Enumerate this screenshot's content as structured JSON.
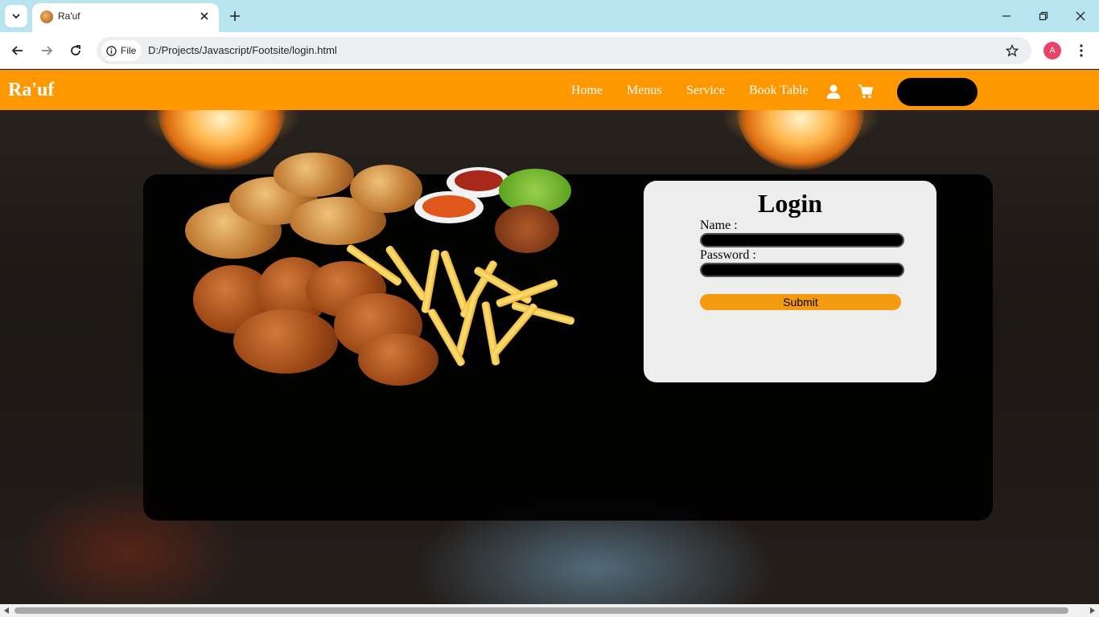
{
  "browser": {
    "tab_title": "Ra'uf",
    "site_chip_label": "File",
    "url": "D:/Projects/Javascript/Footsite/login.html",
    "profile_initial": "A"
  },
  "navbar": {
    "brand": "Ra'uf",
    "links": [
      {
        "label": "Home"
      },
      {
        "label": "Menus"
      },
      {
        "label": "Service"
      },
      {
        "label": "Book Table"
      }
    ],
    "icons": [
      "user-icon",
      "cart-icon"
    ],
    "accent_color": "#ff9800"
  },
  "login": {
    "title": "Login",
    "name_label": "Name :",
    "name_value": "",
    "password_label": "Password :",
    "password_value": "",
    "submit_label": "Submit",
    "submit_color": "#f39a0e"
  }
}
